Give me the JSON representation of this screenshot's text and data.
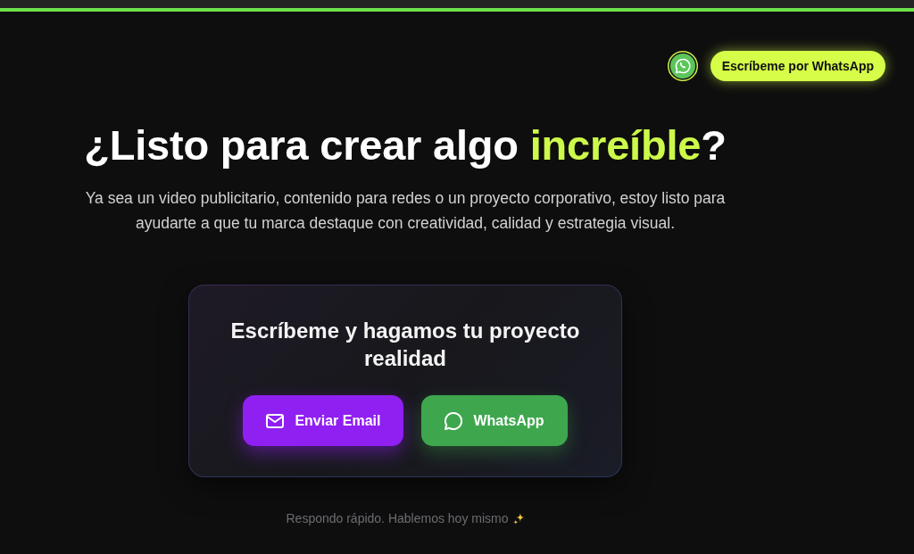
{
  "header": {
    "cta_button": {
      "label": "Escríbeme por WhatsApp"
    }
  },
  "hero": {
    "headline": [
      {
        "text": "¿Listo para crear algo ",
        "highlight": false
      },
      {
        "text": "increíble",
        "highlight": true
      },
      {
        "text": "?",
        "highlight": false
      }
    ],
    "description": "Ya sea un video publicitario, contenido para redes o un proyecto corporativo, estoy listo para ayudarte a que tu marca destaque con creatividad, calidad y estrategia visual."
  },
  "contact_card": {
    "title": "Escríbeme y hagamos tu proyecto realidad",
    "buttons": [
      {
        "kind": "email",
        "label": "Enviar Email"
      },
      {
        "kind": "whatsapp",
        "label": "WhatsApp"
      }
    ]
  },
  "footer_note": {
    "text": "Respondo rápido. Hablemos hoy mismo"
  }
}
